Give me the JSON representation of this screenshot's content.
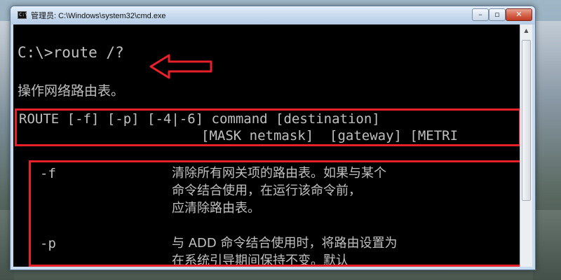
{
  "window": {
    "title": "管理员: C:\\Windows\\system32\\cmd.exe",
    "controls": {
      "minimize": "–",
      "maximize": "▫",
      "close": "✕"
    }
  },
  "console": {
    "prompt": "C:\\>route /?",
    "description": "操作网络路由表。",
    "syntax_line1": "ROUTE [-f] [-p] [-4|-6] command [destination]",
    "syntax_line2": "[MASK netmask]  [gateway] [METRI",
    "options": [
      {
        "name": "-f",
        "desc": "清除所有网关项的路由表。如果与某个\n命令结合使用，在运行该命令前，\n应清除路由表。"
      },
      {
        "name": "-p",
        "desc": "与 ADD 命令结合使用时，将路由设置为\n在系统引导期间保持不变。默认"
      }
    ]
  },
  "annotations": {
    "color": "#e8202a"
  },
  "icons": {
    "app": "cmd-icon",
    "arrow": "red-arrow-icon",
    "scroll_up": "chevron-up-icon"
  }
}
